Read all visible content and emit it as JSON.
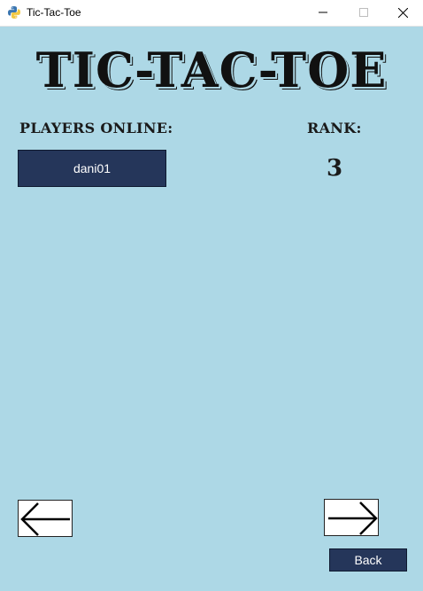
{
  "window": {
    "title": "Tic-Tac-Toe",
    "app_icon": "python-icon",
    "controls": [
      "minimize-icon",
      "maximize-icon",
      "close-icon"
    ]
  },
  "header": {
    "title": "TIC-TAC-TOE"
  },
  "players": {
    "label": "PLAYERS ONLINE:",
    "items": [
      {
        "name": "dani01"
      }
    ]
  },
  "rank": {
    "label": "RANK:",
    "value": "3"
  },
  "navigation": {
    "prev_icon": "arrow-left-icon",
    "next_icon": "arrow-right-icon",
    "back_label": "Back"
  },
  "colors": {
    "background": "#add8e6",
    "button": "#25365a",
    "button_text": "#ffffff",
    "text": "#1a1a1a"
  }
}
